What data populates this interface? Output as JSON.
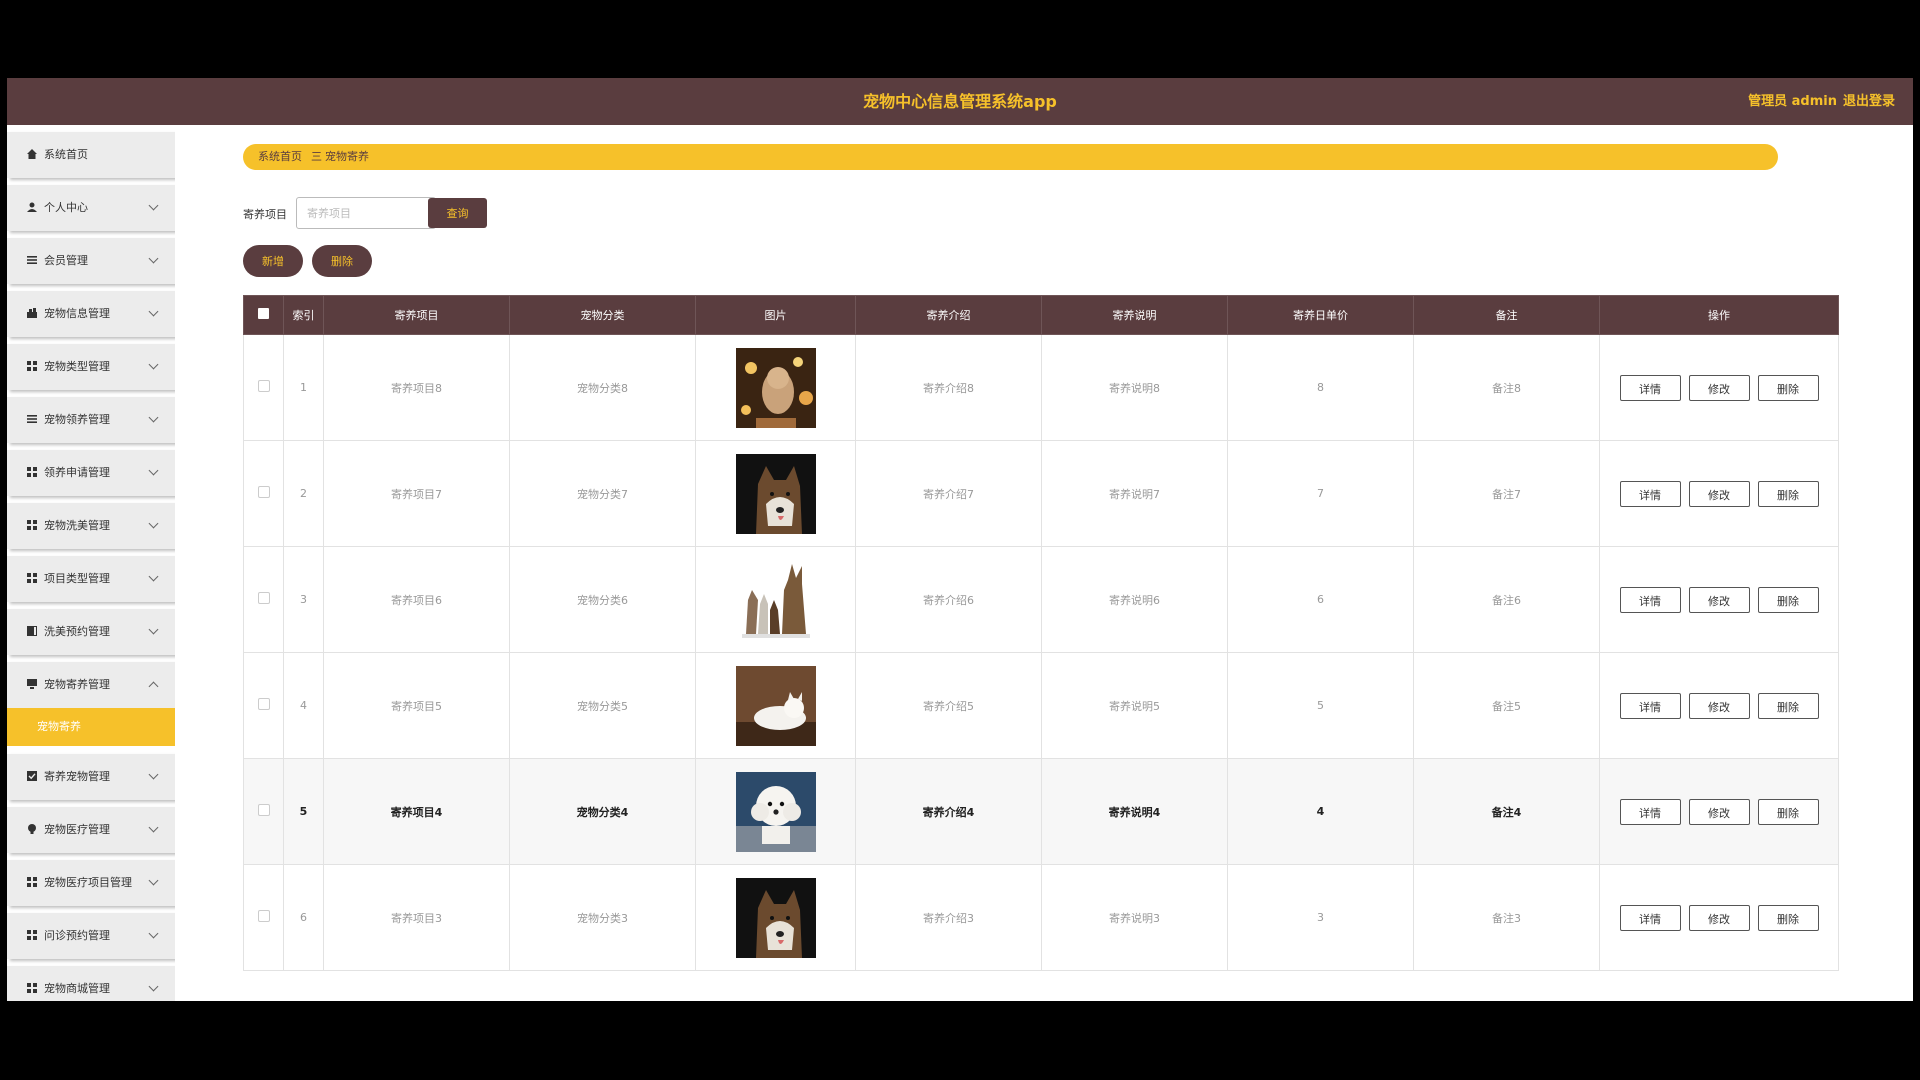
{
  "header": {
    "title": "宠物中心信息管理系统app",
    "user_label": "管理员 admin",
    "logout_label": "退出登录"
  },
  "sidebar": {
    "items": [
      {
        "label": "系统首页",
        "icon": "home-icon"
      },
      {
        "label": "个人中心",
        "icon": "user-icon"
      },
      {
        "label": "会员管理",
        "icon": "list-icon"
      },
      {
        "label": "宠物信息管理",
        "icon": "paw-icon"
      },
      {
        "label": "宠物类型管理",
        "icon": "grid-icon"
      },
      {
        "label": "宠物领养管理",
        "icon": "list-icon"
      },
      {
        "label": "领养申请管理",
        "icon": "grid-icon"
      },
      {
        "label": "宠物洗美管理",
        "icon": "grid-icon"
      },
      {
        "label": "项目类型管理",
        "icon": "grid-icon"
      },
      {
        "label": "洗美预约管理",
        "icon": "book-icon"
      },
      {
        "label": "宠物寄养管理",
        "icon": "monitor-icon"
      },
      {
        "label": "寄养宠物管理",
        "icon": "checkbox-icon"
      },
      {
        "label": "宠物医疗管理",
        "icon": "bulb-icon"
      },
      {
        "label": "宠物医疗项目管理",
        "icon": "grid-icon"
      },
      {
        "label": "问诊预约管理",
        "icon": "grid-icon"
      },
      {
        "label": "宠物商城管理",
        "icon": "grid-icon"
      }
    ],
    "active_sub": "宠物寄养"
  },
  "breadcrumb": {
    "home": "系统首页",
    "separator": "三",
    "current": "宠物寄养"
  },
  "search": {
    "label": "寄养项目",
    "placeholder": "寄养项目",
    "button": "查询"
  },
  "actions": {
    "add": "新增",
    "delete": "删除"
  },
  "table": {
    "columns": [
      "索引",
      "寄养项目",
      "宠物分类",
      "图片",
      "寄养介绍",
      "寄养说明",
      "寄养日单价",
      "备注",
      "操作"
    ],
    "ops": {
      "detail": "详情",
      "edit": "修改",
      "delete": "删除"
    },
    "rows": [
      {
        "index": "1",
        "project": "寄养项目8",
        "category": "宠物分类8",
        "intro": "寄养介绍8",
        "desc": "寄养说明8",
        "price": "8",
        "note": "备注8",
        "image": "cat-lights-photo"
      },
      {
        "index": "2",
        "project": "寄养项目7",
        "category": "宠物分类7",
        "intro": "寄养介绍7",
        "desc": "寄养说明7",
        "price": "7",
        "note": "备注7",
        "image": "husky-photo"
      },
      {
        "index": "3",
        "project": "寄养项目6",
        "category": "宠物分类6",
        "intro": "寄养介绍6",
        "desc": "寄养说明6",
        "price": "6",
        "note": "备注6",
        "image": "dogs-group-photo"
      },
      {
        "index": "4",
        "project": "寄养项目5",
        "category": "宠物分类5",
        "intro": "寄养介绍5",
        "desc": "寄养说明5",
        "price": "5",
        "note": "备注5",
        "image": "white-cat-photo"
      },
      {
        "index": "5",
        "project": "寄养项目4",
        "category": "宠物分类4",
        "intro": "寄养介绍4",
        "desc": "寄养说明4",
        "price": "4",
        "note": "备注4",
        "image": "poodle-photo"
      },
      {
        "index": "6",
        "project": "寄养项目3",
        "category": "宠物分类3",
        "intro": "寄养介绍3",
        "desc": "寄养说明3",
        "price": "3",
        "note": "备注3",
        "image": "husky-photo"
      }
    ]
  },
  "colors": {
    "brand_dark": "#5a3d3f",
    "accent": "#f6c12a"
  }
}
